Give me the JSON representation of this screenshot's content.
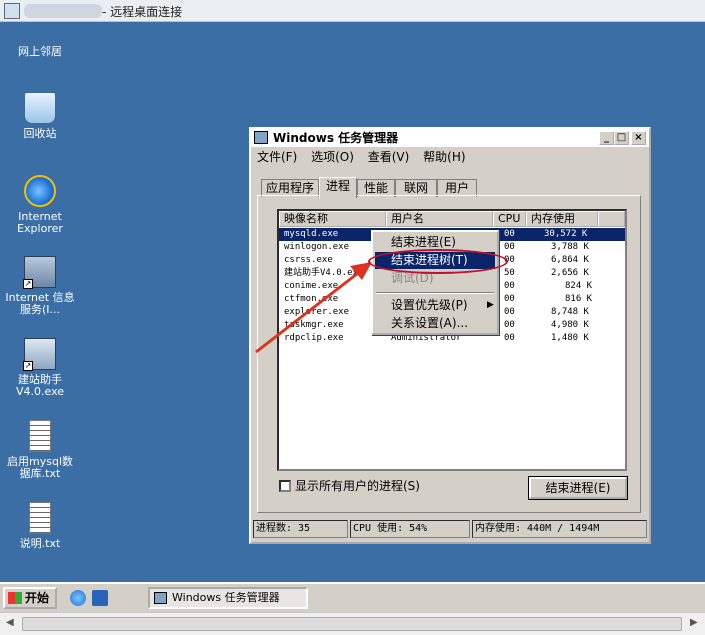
{
  "rdp": {
    "title": "- 远程桌面连接"
  },
  "desktop": {
    "icons": [
      {
        "label": "网上邻居"
      },
      {
        "label": "回收站"
      },
      {
        "label": "Internet Explorer"
      },
      {
        "label": "Internet 信息服务(I..."
      },
      {
        "label": "建站助手 V4.0.exe"
      },
      {
        "label": "启用mysql数据库.txt"
      },
      {
        "label": "说明.txt"
      }
    ]
  },
  "taskmgr": {
    "title": "Windows 任务管理器",
    "menu": [
      "文件(F)",
      "选项(O)",
      "查看(V)",
      "帮助(H)"
    ],
    "tabs": [
      "应用程序",
      "进程",
      "性能",
      "联网",
      "用户"
    ],
    "columns": [
      "映像名称",
      "用户名",
      "CPU",
      "内存使用"
    ],
    "rows": [
      {
        "name": "mysqld.exe",
        "user": "",
        "cpu": "00",
        "mem": "30,572 K"
      },
      {
        "name": "winlogon.exe",
        "user": "",
        "cpu": "00",
        "mem": "3,788 K"
      },
      {
        "name": "csrss.exe",
        "user": "",
        "cpu": "00",
        "mem": "6,864 K"
      },
      {
        "name": "建站助手V4.0.ex",
        "user": "",
        "cpu": "50",
        "mem": "2,656 K"
      },
      {
        "name": "conime.exe",
        "user": "",
        "cpu": "00",
        "mem": "824 K"
      },
      {
        "name": "ctfmon.exe",
        "user": "",
        "cpu": "00",
        "mem": "816 K"
      },
      {
        "name": "explorer.exe",
        "user": "",
        "cpu": "00",
        "mem": "8,748 K"
      },
      {
        "name": "taskmgr.exe",
        "user": "",
        "cpu": "00",
        "mem": "4,980 K"
      },
      {
        "name": "rdpclip.exe",
        "user": "Administrator",
        "cpu": "00",
        "mem": "1,480 K"
      }
    ],
    "show_all_label": "显示所有用户的进程(S)",
    "end_process_button": "结束进程(E)",
    "status": {
      "processes": "进程数: 35",
      "cpu": "CPU 使用: 54%",
      "memory": "内存使用: 440M / 1494M"
    }
  },
  "context_menu": {
    "items": [
      {
        "label": "结束进程(E)",
        "state": "normal"
      },
      {
        "label": "结束进程树(T)",
        "state": "highlighted"
      },
      {
        "label": "调试(D)",
        "state": "disabled"
      },
      {
        "label": "设置优先级(P)",
        "state": "submenu"
      },
      {
        "label": "关系设置(A)...",
        "state": "normal"
      }
    ]
  },
  "taskbar": {
    "start_label": "开始",
    "task_item": "Windows 任务管理器"
  },
  "colors": {
    "desktop": "#3a6ea5",
    "selection": "#0a246a",
    "annotation": "#e03020"
  }
}
